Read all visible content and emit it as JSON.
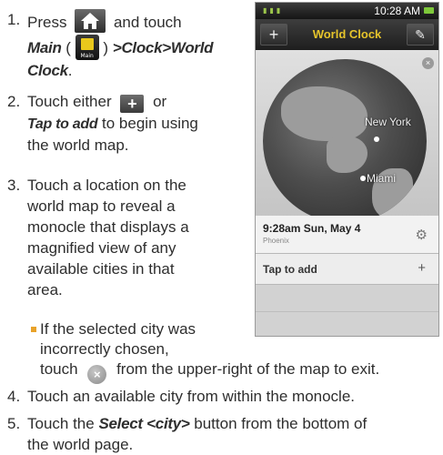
{
  "steps": [
    {
      "num": "1.",
      "pre": "Press",
      "mid": "and touch",
      "main_label": "Main",
      "paren_open": "(",
      "paren_close": ")",
      "sep1": ">",
      "clock": "Clock",
      "sep2": ">",
      "world": "World",
      "world2": "Clock",
      "period": "."
    },
    {
      "num": "2.",
      "line1_pre": "Touch either",
      "or": "or",
      "tap_label": "Tap to add",
      "line2_post": "to begin using",
      "line3": "the world map."
    },
    {
      "num": "3.",
      "lines": [
        "Touch a location on the",
        "world map to reveal a",
        "monocle that displays a",
        "magnified view of any",
        "available cities in that",
        "area."
      ]
    },
    {
      "num": "4.",
      "text": "Touch an available city from within the monocle."
    },
    {
      "num": "5.",
      "pre": "Touch the",
      "select_label": "Select <city>",
      "post": "button from the bottom of",
      "line2": "the world page."
    }
  ],
  "bullet": {
    "line1": "If the selected city was",
    "line2": "incorrectly chosen,",
    "line3_pre": "touch",
    "line3_post": "from the upper-right of the map to exit."
  },
  "icons": {
    "home": "home-icon",
    "main_tile_label": "Main",
    "plus": "+",
    "close": "×"
  },
  "phone": {
    "status_time": "10:28 AM",
    "title": "World Clock",
    "add_button": "+",
    "edit_button": "✎",
    "globe_cities": [
      "New York",
      "Miami"
    ],
    "close_map": "×",
    "entry_time": "9:28am Sun, May 4",
    "entry_city": "Phoenix",
    "tap_to_add": "Tap to add",
    "tap_plus": "+"
  },
  "colors": {
    "bullet": "#e8a22a",
    "title": "#e6c42b",
    "battery": "#7ec83a"
  }
}
